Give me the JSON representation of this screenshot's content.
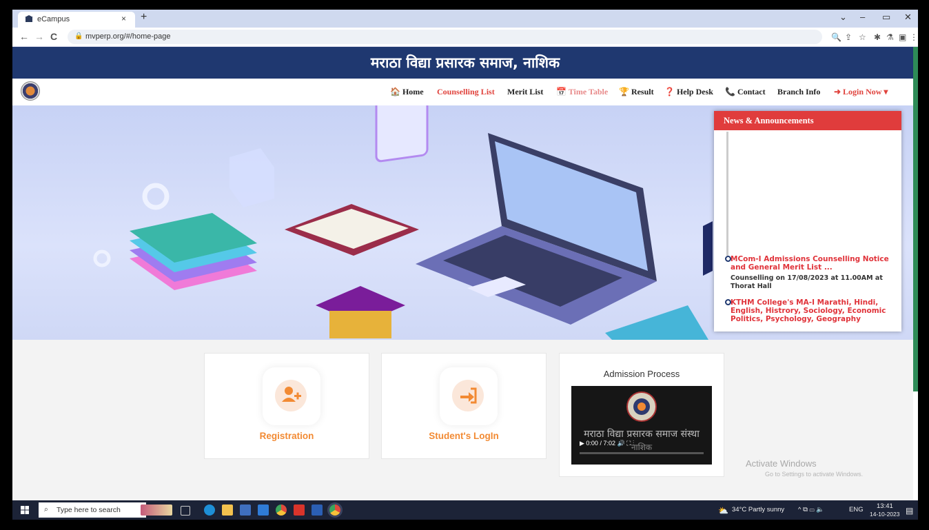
{
  "browser": {
    "tab_title": "eCampus",
    "tab_close": "×",
    "new_tab": "+",
    "url": "mvperp.org/#/home-page",
    "nav_back": "←",
    "nav_forward": "→",
    "nav_reload": "C",
    "win_chevron": "⌄",
    "win_min": "–",
    "win_restore": "▭",
    "win_close": "✕"
  },
  "site": {
    "banner": "मराठा विद्या प्रसारक समाज, नाशिक",
    "nav": {
      "home": "🏠 Home",
      "counselling": "Counselling List",
      "merit": "Merit List",
      "timetable": "📅 Time Table",
      "result": "🏆 Result",
      "helpdesk": "❓ Help Desk",
      "contact": "📞 Contact",
      "branch": "Branch Info",
      "login": "➜ Login Now ▾"
    },
    "news": {
      "header": "News & Announcements",
      "items": [
        {
          "title": "MCom-I Admissions Counselling Notice and General Merit List ...",
          "desc": "Counselling on 17/08/2023 at 11.00AM at Thorat Hall"
        },
        {
          "title": "KTHM College's MA-I Marathi, Hindi, English, Histrory, Sociology, Economic Politics, Psychology, Geography"
        }
      ]
    },
    "cards": {
      "registration": "Registration",
      "student_login": "Student's LogIn",
      "admission_title": "Admission Process"
    },
    "video": {
      "overlay_line1": "मराठा विद्या प्रसारक समाज संस्था",
      "overlay_line2": "नाशिक",
      "time": "▶   0:00 / 7:02        🔊    ⛶    ⋮"
    },
    "activate": {
      "title": "Activate Windows",
      "subtitle": "Go to Settings to activate Windows."
    }
  },
  "taskbar": {
    "search_placeholder": "Type here to search",
    "weather": "34°C  Partly sunny",
    "lang": "ENG",
    "time": "13:41",
    "date": "14-10-2023"
  },
  "colors": {
    "banner_blue": "#1f3870",
    "accent_red": "#e03c3c",
    "card_orange": "#f28a33"
  }
}
